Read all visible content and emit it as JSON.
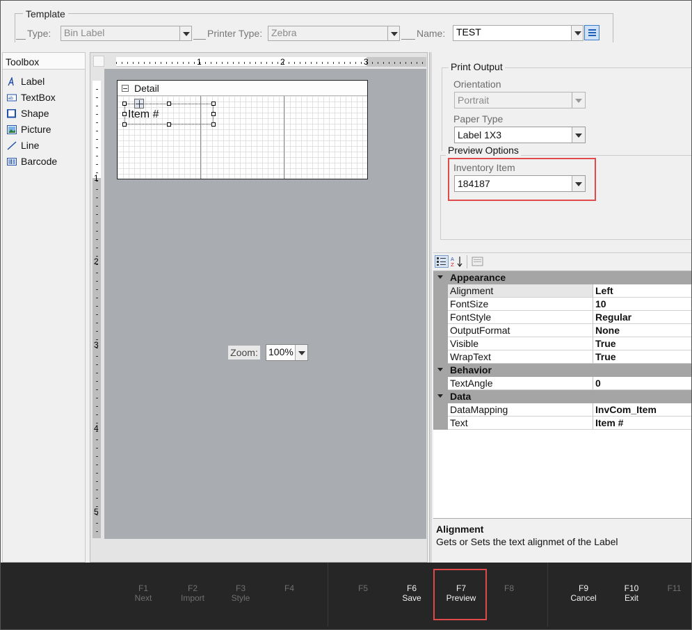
{
  "template": {
    "group_title": "Template",
    "type_label": "Type:",
    "type_value": "Bin Label",
    "printer_type_label": "Printer Type:",
    "printer_type_value": "Zebra",
    "name_label": "Name:",
    "name_value": "TEST"
  },
  "toolbox": {
    "title": "Toolbox",
    "items": [
      {
        "label": "Label",
        "icon": "label-icon"
      },
      {
        "label": "TextBox",
        "icon": "textbox-icon"
      },
      {
        "label": "Shape",
        "icon": "shape-icon"
      },
      {
        "label": "Picture",
        "icon": "picture-icon"
      },
      {
        "label": "Line",
        "icon": "line-icon"
      },
      {
        "label": "Barcode",
        "icon": "barcode-icon"
      }
    ]
  },
  "designer": {
    "ruler_top_numbers": [
      "1",
      "2",
      "3"
    ],
    "ruler_left_numbers": [
      "1",
      "2",
      "3",
      "4",
      "5"
    ],
    "band_title": "Detail",
    "label_text": "Item #",
    "zoom_label": "Zoom:",
    "zoom_value": "100%"
  },
  "print_output": {
    "title": "Print Output",
    "orientation_label": "Orientation",
    "orientation_value": "Portrait",
    "paper_type_label": "Paper Type",
    "paper_type_value": "Label 1X3"
  },
  "preview_options": {
    "title": "Preview Options",
    "inventory_item_label": "Inventory Item",
    "inventory_item_value": "184187",
    "highlight_color": "#e04a4a"
  },
  "properties": {
    "categories": [
      {
        "name": "Appearance",
        "props": [
          {
            "name": "Alignment",
            "value": "Left"
          },
          {
            "name": "FontSize",
            "value": "10"
          },
          {
            "name": "FontStyle",
            "value": "Regular"
          },
          {
            "name": "OutputFormat",
            "value": "None"
          },
          {
            "name": "Visible",
            "value": "True"
          },
          {
            "name": "WrapText",
            "value": "True"
          }
        ]
      },
      {
        "name": "Behavior",
        "props": [
          {
            "name": "TextAngle",
            "value": "0"
          }
        ]
      },
      {
        "name": "Data",
        "props": [
          {
            "name": "DataMapping",
            "value": "InvCom_Item"
          },
          {
            "name": "Text",
            "value": "Item #"
          }
        ]
      }
    ],
    "description_title": "Alignment",
    "description_text": "Gets or Sets the text alignmet of the Label"
  },
  "fkeys": [
    {
      "key": "F1",
      "label": "Next",
      "enabled": false
    },
    {
      "key": "F2",
      "label": "Import",
      "enabled": false
    },
    {
      "key": "F3",
      "label": "Style",
      "enabled": false
    },
    {
      "key": "F4",
      "label": "",
      "enabled": false
    },
    {
      "key": "F5",
      "label": "",
      "enabled": false
    },
    {
      "key": "F6",
      "label": "Save",
      "enabled": true
    },
    {
      "key": "F7",
      "label": "Preview",
      "enabled": true
    },
    {
      "key": "F8",
      "label": "",
      "enabled": false
    },
    {
      "key": "F9",
      "label": "Cancel",
      "enabled": true
    },
    {
      "key": "F10",
      "label": "Exit",
      "enabled": true
    },
    {
      "key": "F11",
      "label": "",
      "enabled": false
    }
  ]
}
